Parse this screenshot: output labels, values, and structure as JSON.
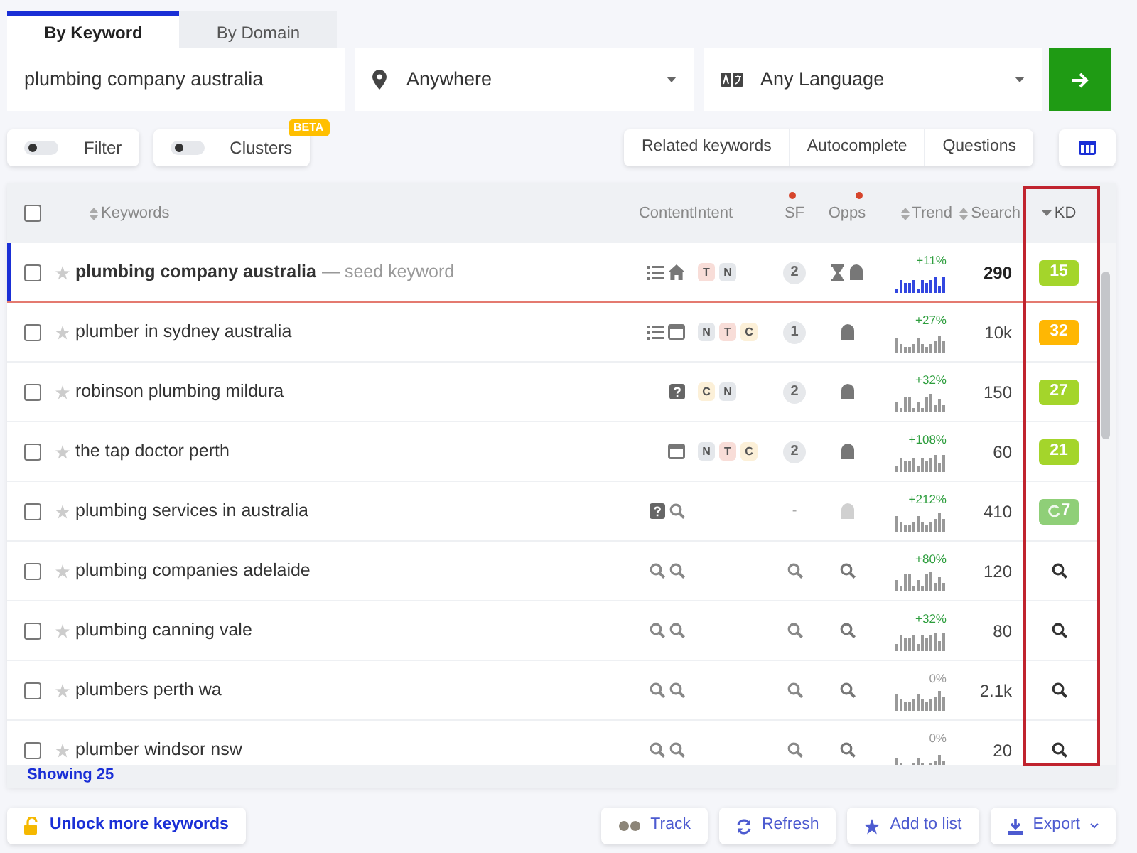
{
  "tabs": [
    {
      "label": "By Keyword",
      "selected": true
    },
    {
      "label": "By Domain",
      "selected": false
    }
  ],
  "search": {
    "value": "plumbing company australia",
    "location": "Anywhere",
    "language": "Any Language"
  },
  "toggles": [
    {
      "label": "Filter",
      "on": false
    },
    {
      "label": "Clusters",
      "on": false,
      "badge": "BETA"
    }
  ],
  "sources": [
    "Related keywords",
    "Autocomplete",
    "Questions"
  ],
  "table": {
    "checked": false,
    "kd_outlined": true,
    "columns": [
      {
        "label": "Keywords",
        "sortable": true,
        "sorted": false,
        "alert": false
      },
      {
        "label": "Content",
        "sortable": false,
        "sorted": false,
        "alert": false
      },
      {
        "label": "Intent",
        "sortable": false,
        "sorted": false,
        "alert": false
      },
      {
        "label": "SF",
        "sortable": false,
        "sorted": false,
        "alert": true
      },
      {
        "label": "Opps",
        "sortable": false,
        "sorted": false,
        "alert": true
      },
      {
        "label": "Trend",
        "sortable": true,
        "sorted": false,
        "alert": false
      },
      {
        "label": "Search",
        "sortable": true,
        "sorted": false,
        "alert": false
      },
      {
        "label": "KD",
        "sortable": true,
        "sorted": true,
        "alert": false
      }
    ],
    "rows": [
      {
        "keyword": "plumbing company australia",
        "note": "— seed keyword",
        "seed": true,
        "checked": false,
        "content": [
          {
            "kind": "list"
          },
          {
            "kind": "home"
          }
        ],
        "intent": [
          {
            "letter": "T",
            "color": "#f8ddd8"
          },
          {
            "letter": "N",
            "color": "#e4e7eb"
          }
        ],
        "sf": {
          "kind": "count",
          "text": "2"
        },
        "opps": [
          {
            "kind": "hourglass",
            "dim": false
          },
          {
            "kind": "ghost",
            "dim": false
          }
        ],
        "trend": {
          "text": "+11%",
          "color": "#2e9e3e"
        },
        "search": "290",
        "kd": {
          "kind": "score",
          "value": "15",
          "color": "#a4d52b",
          "updating": false
        }
      },
      {
        "keyword": "plumber in sydney australia",
        "seed": false,
        "checked": false,
        "content": [
          {
            "kind": "list"
          },
          {
            "kind": "window"
          }
        ],
        "intent": [
          {
            "letter": "N",
            "color": "#e4e7eb"
          },
          {
            "letter": "T",
            "color": "#f8ddd8"
          },
          {
            "letter": "C",
            "color": "#fcf0d8"
          }
        ],
        "sf": {
          "kind": "count",
          "text": "1"
        },
        "opps": [
          {
            "kind": "ghost",
            "dim": false
          }
        ],
        "trend": {
          "text": "+27%",
          "color": "#2e9e3e"
        },
        "search": "10k",
        "kd": {
          "kind": "score",
          "value": "32",
          "color": "#ffb703",
          "updating": false
        }
      },
      {
        "keyword": "robinson plumbing mildura",
        "seed": false,
        "checked": false,
        "content": [
          {
            "kind": "help"
          }
        ],
        "intent": [
          {
            "letter": "C",
            "color": "#fcf0d8"
          },
          {
            "letter": "N",
            "color": "#e4e7eb"
          }
        ],
        "sf": {
          "kind": "count",
          "text": "2"
        },
        "opps": [
          {
            "kind": "ghost",
            "dim": false
          }
        ],
        "trend": {
          "text": "+32%",
          "color": "#2e9e3e"
        },
        "search": "150",
        "kd": {
          "kind": "score",
          "value": "27",
          "color": "#a4d52b",
          "updating": false
        }
      },
      {
        "keyword": "the tap doctor perth",
        "seed": false,
        "checked": false,
        "content": [
          {
            "kind": "window"
          }
        ],
        "intent": [
          {
            "letter": "N",
            "color": "#e4e7eb"
          },
          {
            "letter": "T",
            "color": "#f8ddd8"
          },
          {
            "letter": "C",
            "color": "#fcf0d8"
          }
        ],
        "sf": {
          "kind": "count",
          "text": "2"
        },
        "opps": [
          {
            "kind": "ghost",
            "dim": false
          }
        ],
        "trend": {
          "text": "+108%",
          "color": "#2e9e3e"
        },
        "search": "60",
        "kd": {
          "kind": "score",
          "value": "21",
          "color": "#a4d52b",
          "updating": false
        }
      },
      {
        "keyword": "plumbing services in australia",
        "seed": false,
        "checked": false,
        "content": [
          {
            "kind": "help"
          },
          {
            "kind": "search"
          }
        ],
        "sf": {
          "kind": "dash",
          "text": "-"
        },
        "opps": [
          {
            "kind": "ghost",
            "dim": true
          }
        ],
        "trend": {
          "text": "+212%",
          "color": "#2e9e3e"
        },
        "search": "410",
        "kd": {
          "kind": "score",
          "value": "7",
          "color": "#8fcf78",
          "updating": true
        }
      },
      {
        "keyword": "plumbing companies adelaide",
        "seed": false,
        "checked": false,
        "content": [
          {
            "kind": "search"
          },
          {
            "kind": "search"
          }
        ],
        "sf": {
          "kind": "lookup"
        },
        "opps": [
          {
            "kind": "search",
            "dim": false
          }
        ],
        "trend": {
          "text": "+80%",
          "color": "#2e9e3e"
        },
        "search": "120",
        "kd": {
          "kind": "lookup"
        }
      },
      {
        "keyword": "plumbing canning vale",
        "seed": false,
        "checked": false,
        "content": [
          {
            "kind": "search"
          },
          {
            "kind": "search"
          }
        ],
        "sf": {
          "kind": "lookup"
        },
        "opps": [
          {
            "kind": "search",
            "dim": false
          }
        ],
        "trend": {
          "text": "+32%",
          "color": "#2e9e3e"
        },
        "search": "80",
        "kd": {
          "kind": "lookup"
        }
      },
      {
        "keyword": "plumbers perth wa",
        "seed": false,
        "checked": false,
        "content": [
          {
            "kind": "search"
          },
          {
            "kind": "search"
          }
        ],
        "sf": {
          "kind": "lookup"
        },
        "opps": [
          {
            "kind": "search",
            "dim": false
          }
        ],
        "trend": {
          "text": "0%",
          "color": "#9a9a9a"
        },
        "search": "2.1k",
        "kd": {
          "kind": "lookup"
        }
      },
      {
        "keyword": "plumber windsor nsw",
        "seed": false,
        "checked": false,
        "content": [
          {
            "kind": "search"
          },
          {
            "kind": "search"
          }
        ],
        "sf": {
          "kind": "lookup"
        },
        "opps": [
          {
            "kind": "search",
            "dim": false
          }
        ],
        "trend": {
          "text": "0%",
          "color": "#9a9a9a"
        },
        "search": "20",
        "kd": {
          "kind": "lookup"
        }
      }
    ],
    "footer": "Showing 25"
  },
  "unlock": "Unlock more keywords",
  "actions": [
    {
      "kind": "track",
      "label": "Track",
      "menu": false
    },
    {
      "kind": "refresh",
      "label": "Refresh",
      "menu": false
    },
    {
      "kind": "star",
      "label": "Add to list",
      "menu": false
    },
    {
      "kind": "download",
      "label": "Export",
      "menu": true
    }
  ]
}
